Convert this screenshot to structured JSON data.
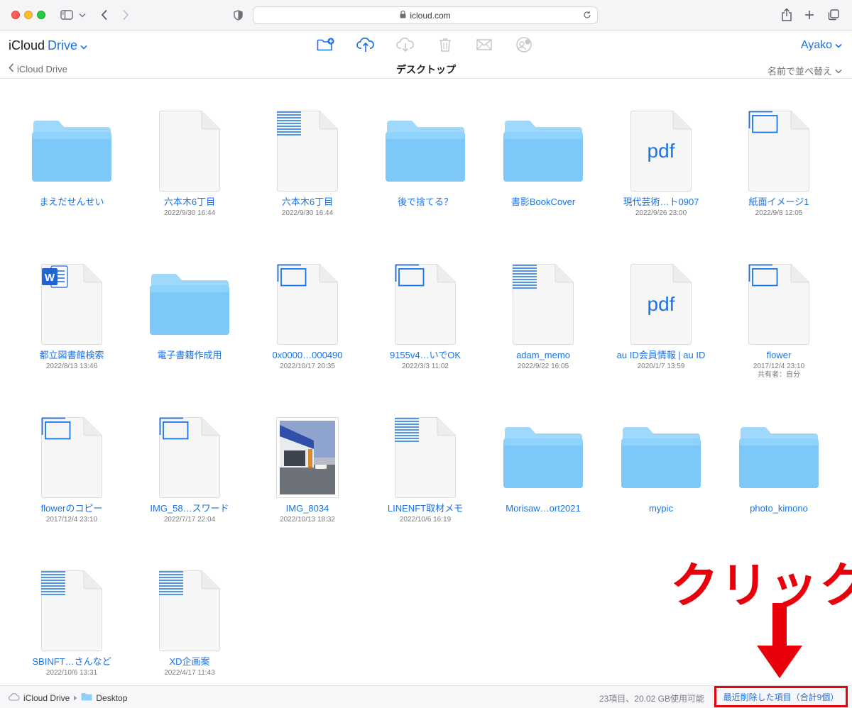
{
  "browser": {
    "url": "icloud.com"
  },
  "app": {
    "title_prefix": "iCloud",
    "title_drive": "Drive",
    "account_name": "Ayako",
    "toolbar": {
      "new_folder_icon": "folder-plus-icon",
      "upload_icon": "cloud-upload-icon",
      "download_icon": "cloud-download-icon",
      "delete_icon": "trash-icon",
      "mail_icon": "mail-icon",
      "share_icon": "add-people-icon"
    }
  },
  "pathbar": {
    "back_label": "iCloud Drive",
    "folder_title": "デスクトップ",
    "sort_label": "名前で並べ替え"
  },
  "items": [
    {
      "type": "folder",
      "name": "まえだせんせい",
      "date": ""
    },
    {
      "type": "blank",
      "name": "六本木6丁目",
      "date": "2022/9/30 16:44"
    },
    {
      "type": "text",
      "name": "六本木6丁目",
      "date": "2022/9/30 16:44"
    },
    {
      "type": "folder",
      "name": "後で捨てる？",
      "date": ""
    },
    {
      "type": "folder",
      "name": "書影BookCover",
      "date": ""
    },
    {
      "type": "pdf",
      "name": "現代芸術…ト0907",
      "date": "2022/9/26 23:00"
    },
    {
      "type": "image",
      "name": "紙面イメージ1",
      "date": "2022/9/8 12:05"
    },
    {
      "type": "word",
      "name": "都立図書館検索",
      "date": "2022/8/13 13:46"
    },
    {
      "type": "folder",
      "name": "電子書籍作成用",
      "date": ""
    },
    {
      "type": "image",
      "name": "0x0000…000490",
      "date": "2022/10/17 20:35"
    },
    {
      "type": "image",
      "name": "9155v4…いでOK",
      "date": "2022/3/3 11:02"
    },
    {
      "type": "text",
      "name": "adam_memo",
      "date": "2022/9/22 16:05"
    },
    {
      "type": "pdf",
      "name": "au ID会員情報 | au ID",
      "date": "2020/1/7 13:59"
    },
    {
      "type": "image",
      "name": "flower",
      "date": "2017/12/4 23:10",
      "sub": "共有者：自分"
    },
    {
      "type": "image",
      "name": "flowerのコピー",
      "date": "2017/12/4 23:10"
    },
    {
      "type": "image",
      "name": "IMG_58…スワード",
      "date": "2022/7/17 22:04"
    },
    {
      "type": "photo",
      "name": "IMG_8034",
      "date": "2022/10/13 18:32"
    },
    {
      "type": "text",
      "name": "LINENFT取材メモ",
      "date": "2022/10/6 16:19"
    },
    {
      "type": "folder",
      "name": "Morisaw…ort2021",
      "date": ""
    },
    {
      "type": "folder",
      "name": "mypic",
      "date": ""
    },
    {
      "type": "folder",
      "name": "photo_kimono",
      "date": ""
    },
    {
      "type": "text",
      "name": "SBINFT…さんなど",
      "date": "2022/10/6 13:31"
    },
    {
      "type": "text",
      "name": "XD企画案",
      "date": "2022/4/17 11:43"
    }
  ],
  "pdf_label": "pdf",
  "word_label": "W",
  "statusbar": {
    "crumb_root": "iCloud Drive",
    "crumb_folder": "Desktop",
    "storage": "23項目、20.02 GB使用可能",
    "recently_deleted": "最近削除した項目（合計9個）"
  },
  "annotation": {
    "text": "クリック"
  },
  "colors": {
    "accent": "#1a73e8",
    "folder": "#7cc8f8",
    "annotation": "#e8000b"
  }
}
